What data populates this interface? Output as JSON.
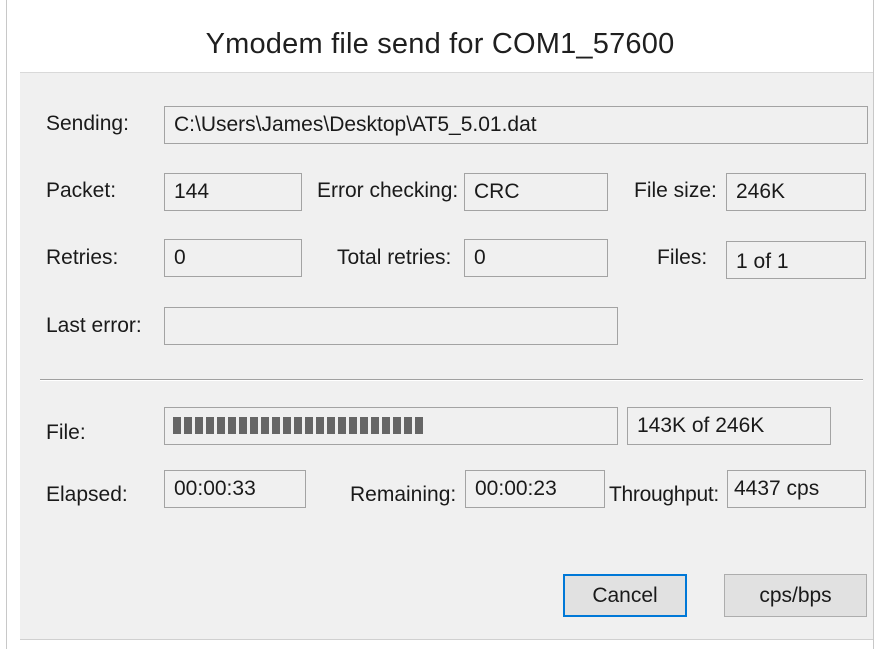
{
  "window": {
    "title": "Ymodem file send for COM1_57600"
  },
  "fields": {
    "sending_label": "Sending:",
    "sending_value": "C:\\Users\\James\\Desktop\\AT5_5.01.dat",
    "packet_label": "Packet:",
    "packet_value": "144",
    "error_checking_label": "Error checking:",
    "error_checking_value": "CRC",
    "file_size_label": "File size:",
    "file_size_value": "246K",
    "retries_label": "Retries:",
    "retries_value": "0",
    "total_retries_label": "Total retries:",
    "total_retries_value": "0",
    "files_label": "Files:",
    "files_value": "1 of 1",
    "last_error_label": "Last error:",
    "last_error_value": ""
  },
  "progress": {
    "file_label": "File:",
    "fraction": 0.581,
    "value_text": "143K of 246K"
  },
  "stats": {
    "elapsed_label": "Elapsed:",
    "elapsed_value": "00:00:33",
    "remaining_label": "Remaining:",
    "remaining_value": "00:00:23",
    "throughput_label": "Throughput:",
    "throughput_value": "4437 cps"
  },
  "buttons": {
    "cancel": "Cancel",
    "cps_bps": "cps/bps"
  },
  "colors": {
    "accent": "#0078d7",
    "dialog_bg": "#f0f0f0",
    "progress_fill": "#666666"
  }
}
